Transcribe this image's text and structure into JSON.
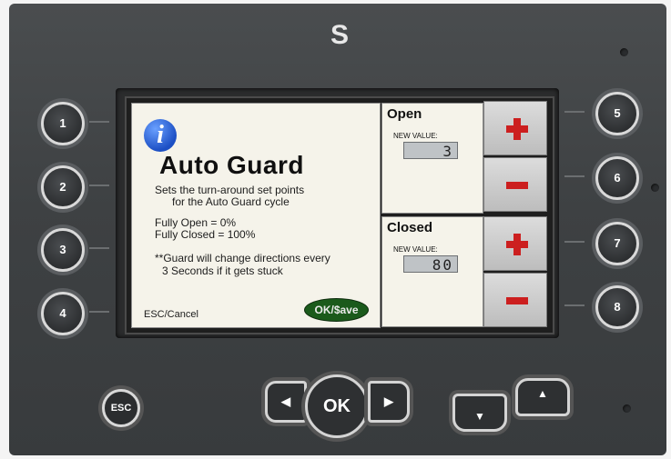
{
  "device": {
    "logo": "S"
  },
  "screen": {
    "info_icon": "i",
    "title": "Auto Guard",
    "description_line1": "Sets the turn-around set points",
    "description_line2": "for the Auto Guard cycle",
    "fully_open": "Fully Open = 0%",
    "fully_closed": "Fully Closed = 100%",
    "note_line1": "**Guard will change directions every",
    "note_line2": "3 Seconds if it gets stuck",
    "esc_cancel": "ESC/Cancel",
    "ok_save": "OK/$ave"
  },
  "open_panel": {
    "title": "Open",
    "label": "NEW VALUE:",
    "value": "3"
  },
  "closed_panel": {
    "title": "Closed",
    "label": "NEW VALUE:",
    "value": "80"
  },
  "side_buttons": {
    "plus_icon": "plus-icon",
    "minus_icon": "minus-icon",
    "accent_color": "#cc1f1f"
  },
  "softkeys": {
    "left": [
      "1",
      "2",
      "3",
      "4"
    ],
    "right": [
      "5",
      "6",
      "7",
      "8"
    ]
  },
  "nav": {
    "esc": "ESC",
    "ok": "OK",
    "left": "◀",
    "right": "▶",
    "down": "▼",
    "up": "▲"
  }
}
